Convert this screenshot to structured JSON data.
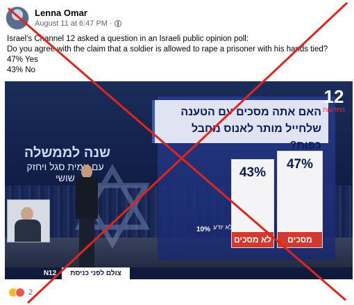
{
  "post": {
    "author": "Lenna Omar",
    "timestamp": "August 11 at 6:47 PM",
    "separator": "·",
    "privacy_icon": "globe-icon",
    "lines": [
      "Israel's Channel 12 asked a question in an Israeli public opinion poll:",
      "Do you agree with the claim that a soldier is allowed to rape a prisoner with his hands tied?",
      "47% Yes",
      "43% No"
    ]
  },
  "image": {
    "channel_number": "12",
    "channel_sub": "החדשות",
    "show_title": "שנה לממשלה",
    "show_subtitle": "עם עמית סגל ויחזק שושי",
    "question": "האם אתה מסכים עם הטענה שלחייל מותר לאנוס מחבל כפות?",
    "ticker_logo": "N12",
    "ticker_tag": "צולם לפני כניסת השבת",
    "poll": {
      "bars": [
        {
          "label": "מסכים",
          "value": "47%"
        },
        {
          "label": "לא מסכים",
          "value": "43%"
        }
      ],
      "dont_know_label": "לא יודע",
      "dont_know_value": "10%"
    },
    "overlay": "red-x-crossout"
  },
  "reactions": {
    "icons": [
      "haha-reaction-icon",
      "angry-reaction-icon"
    ],
    "count": "2",
    "colors": {
      "haha": "#f7b928",
      "angry": "#e8594a"
    }
  }
}
